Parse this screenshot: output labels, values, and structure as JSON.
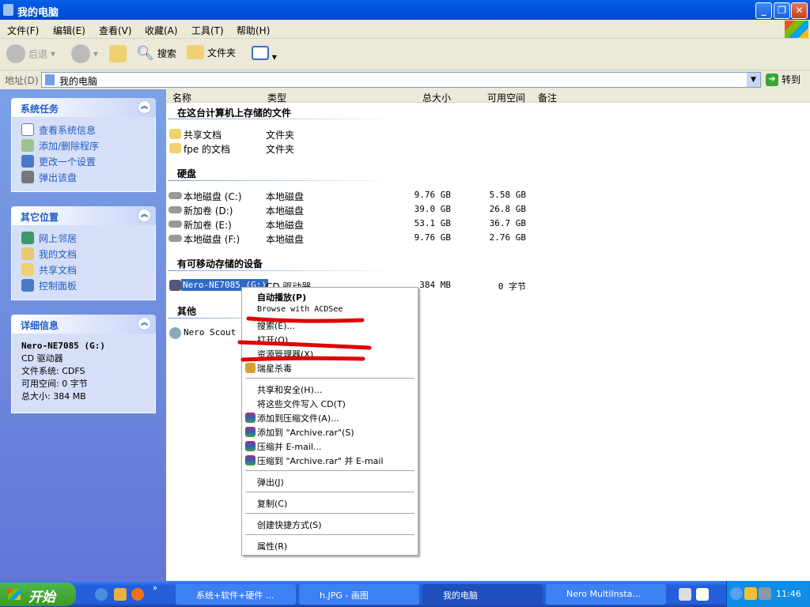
{
  "window": {
    "title": "我的电脑"
  },
  "menu": [
    "文件(F)",
    "编辑(E)",
    "查看(V)",
    "收藏(A)",
    "工具(T)",
    "帮助(H)"
  ],
  "toolbar": {
    "back": "后退",
    "search": "搜索",
    "folders": "文件夹"
  },
  "address": {
    "label": "地址(D)",
    "value": "我的电脑",
    "go": "转到"
  },
  "panels": {
    "tasks": {
      "title": "系统任务",
      "items": [
        "查看系统信息",
        "添加/删除程序",
        "更改一个设置",
        "弹出该盘"
      ]
    },
    "places": {
      "title": "其它位置",
      "items": [
        "网上邻居",
        "我的文档",
        "共享文档",
        "控制面板"
      ]
    },
    "details": {
      "title": "详细信息",
      "name": "Nero-NE7085 (G:)",
      "type": "CD 驱动器",
      "fs": "文件系统: CDFS",
      "free": "可用空间: 0 字节",
      "total": "总大小: 384 MB"
    }
  },
  "columns": [
    "名称",
    "类型",
    "总大小",
    "可用空间",
    "备注"
  ],
  "groups": {
    "files": {
      "title": "在这台计算机上存储的文件",
      "rows": [
        {
          "name": "共享文档",
          "type": "文件夹"
        },
        {
          "name": "fpe 的文档",
          "type": "文件夹"
        }
      ]
    },
    "disks": {
      "title": "硬盘",
      "rows": [
        {
          "name": "本地磁盘 (C:)",
          "type": "本地磁盘",
          "size": "9.76 GB",
          "free": "5.58 GB"
        },
        {
          "name": "新加卷 (D:)",
          "type": "本地磁盘",
          "size": "39.0 GB",
          "free": "26.8 GB"
        },
        {
          "name": "新加卷 (E:)",
          "type": "本地磁盘",
          "size": "53.1 GB",
          "free": "36.7 GB"
        },
        {
          "name": "本地磁盘 (F:)",
          "type": "本地磁盘",
          "size": "9.76 GB",
          "free": "2.76 GB"
        }
      ]
    },
    "removable": {
      "title": "有可移动存储的设备",
      "rows": [
        {
          "name": "Nero-NE7085 (G:)",
          "type": "CD 驱动器",
          "size": "384 MB",
          "free": "0 字节"
        }
      ]
    },
    "other": {
      "title": "其他",
      "rows": [
        {
          "name": "Nero Scout"
        }
      ]
    }
  },
  "context_menu": [
    "自动播放(P)",
    "Browse with ACDSee",
    "搜索(E)...",
    "打开(O)",
    "资源管理器(X)",
    "瑞星杀毒",
    "共享和安全(H)...",
    "将这些文件写入 CD(T)",
    "添加到压缩文件(A)...",
    "添加到 \"Archive.rar\"(S)",
    "压缩并 E-mail...",
    "压缩到 \"Archive.rar\" 并 E-mail",
    "弹出(J)",
    "复制(C)",
    "创建快捷方式(S)",
    "属性(R)"
  ],
  "taskbar": {
    "start": "开始",
    "tasks": [
      "系统+软件+硬件 ...",
      "h.JPG - 画图",
      "我的电脑",
      "Nero MultiInsta..."
    ],
    "clock": "11:46"
  },
  "colors": {
    "titlebar": "#0054e3",
    "annotation": "#e00000",
    "taskpane": "#6f8fdc"
  }
}
